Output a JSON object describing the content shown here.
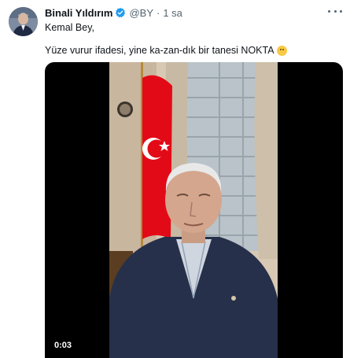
{
  "tweet": {
    "author_name": "Binali Yıldırım",
    "handle": "@BY",
    "separator": "·",
    "time": "1 sa",
    "text_line1": "Kemal Bey,",
    "text_line2": "Yüze vurur ifadesi, yine ka-zan-dık bir tanesi NOKTA",
    "emoji_icon": "slightly-smiling-face-icon",
    "verified_icon": "verified-badge-icon",
    "more_icon": "more-options-icon"
  },
  "video": {
    "duration": "0:03"
  },
  "colors": {
    "verified_blue": "#1d9bf0",
    "secondary_text": "#536471",
    "flag_red": "#e30a17"
  }
}
